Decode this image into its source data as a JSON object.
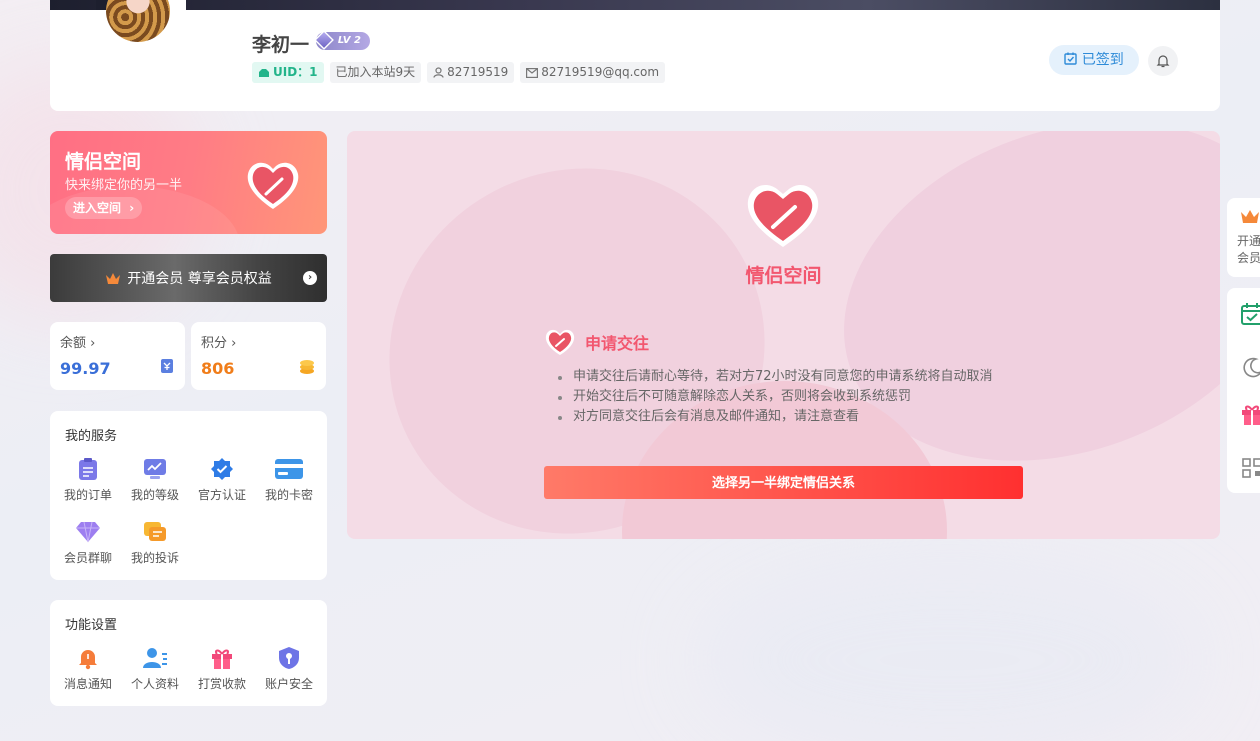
{
  "profile": {
    "username": "李初一",
    "level": "LV 2",
    "uid_label": "UID：1",
    "joined": "已加入本站9天",
    "account": "82719519",
    "email": "82719519@qq.com"
  },
  "header": {
    "checkin_label": "已签到"
  },
  "couple_banner": {
    "title": "情侣空间",
    "subtitle": "快来绑定你的另一半",
    "enter_label": "进入空间"
  },
  "vip_bar": {
    "label": "开通会员 尊享会员权益"
  },
  "stats": {
    "balance": {
      "label": "余额",
      "value": "99.97"
    },
    "points": {
      "label": "积分",
      "value": "806"
    }
  },
  "services": {
    "title": "我的服务",
    "items": [
      {
        "label": "我的订单",
        "icon": "order-icon"
      },
      {
        "label": "我的等级",
        "icon": "level-chart-icon"
      },
      {
        "label": "官方认证",
        "icon": "verified-badge-icon"
      },
      {
        "label": "我的卡密",
        "icon": "card-icon"
      },
      {
        "label": "会员群聊",
        "icon": "diamond-icon"
      },
      {
        "label": "我的投诉",
        "icon": "complaint-icon"
      }
    ]
  },
  "settings": {
    "title": "功能设置",
    "items": [
      {
        "label": "消息通知",
        "icon": "bell-icon"
      },
      {
        "label": "个人资料",
        "icon": "profile-icon"
      },
      {
        "label": "打赏收款",
        "icon": "gift-icon"
      },
      {
        "label": "账户安全",
        "icon": "shield-icon"
      }
    ]
  },
  "main": {
    "title": "情侣空间",
    "apply_title": "申请交往",
    "rules": [
      "申请交往后请耐心等待，若对方72小时没有同意您的申请系统将自动取消",
      "开始交往后不可随意解除恋人关系，否则将会收到系统惩罚",
      "对方同意交往后会有消息及邮件通知，请注意查看"
    ],
    "bind_button": "选择另一半绑定情侣关系"
  },
  "float_toolbar": {
    "vip_text_line1": "开通",
    "vip_text_line2": "会员"
  },
  "colors": {
    "accent_pink": "#f2576f",
    "checkin_blue": "#2e8bd8",
    "balance_blue": "#3a6fd8",
    "points_orange": "#f07d1a"
  }
}
